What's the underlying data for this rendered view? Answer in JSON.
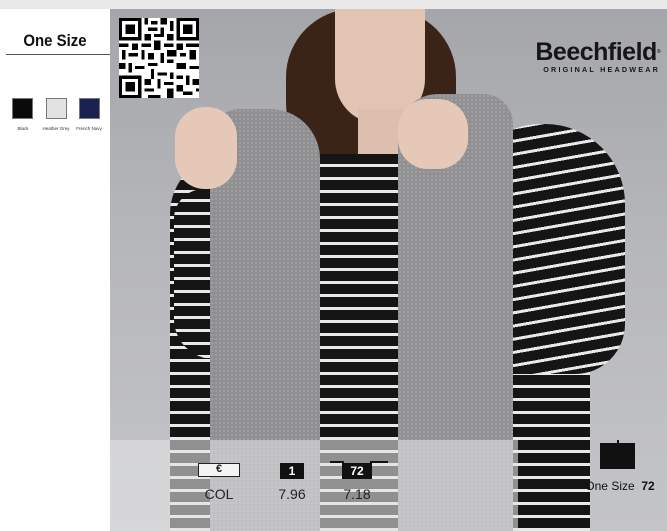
{
  "sizes": {
    "title": "One Size"
  },
  "swatches": [
    {
      "name": "Black",
      "color": "#0a0a0a"
    },
    {
      "name": "Heather Grey",
      "color": "#e2e2e2"
    },
    {
      "name": "French Navy",
      "color": "#1b2150"
    }
  ],
  "brand": {
    "name": "Beechfield",
    "registered": "®",
    "tagline": "ORIGINAL HEADWEAR"
  },
  "qr_code": {
    "icon": "qr-code-icon"
  },
  "pricing": {
    "currency": "€",
    "col_label": "COL",
    "tiers": [
      {
        "qty": "1",
        "price": "7.96"
      },
      {
        "qty": "72",
        "price": "7.18"
      }
    ]
  },
  "packaging": {
    "icon": "box-icon",
    "label": "One Size",
    "count": "72"
  }
}
